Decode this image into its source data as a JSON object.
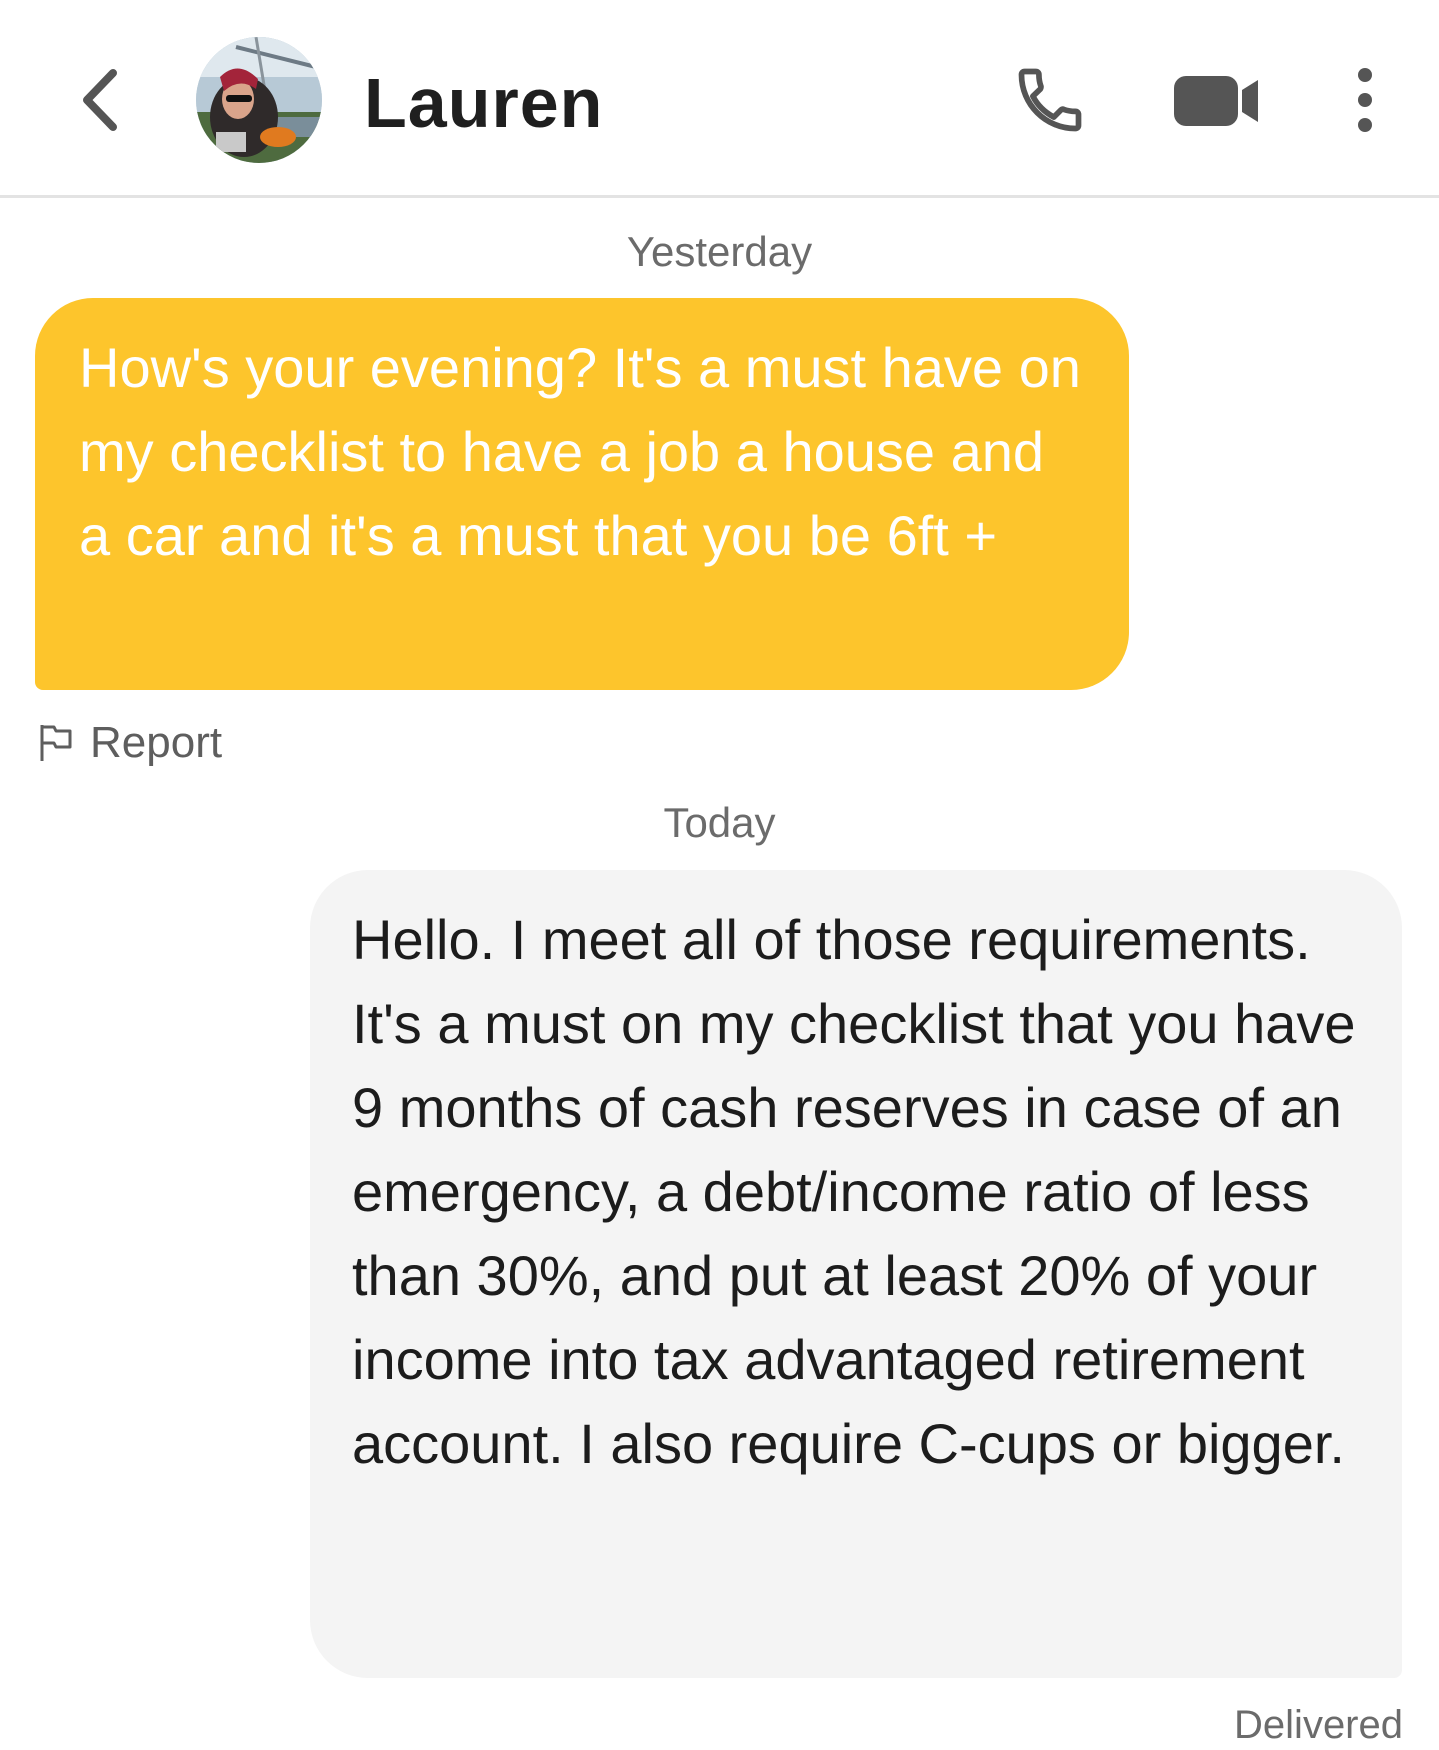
{
  "header": {
    "back_icon": "chevron-left-icon",
    "contact_name": "Lauren",
    "avatar": "contact-avatar",
    "call_icon": "phone-icon",
    "video_icon": "video-camera-icon",
    "more_icon": "more-vertical-icon"
  },
  "conversation": {
    "sections": [
      {
        "date_label": "Yesterday",
        "messages": [
          {
            "direction": "incoming",
            "text": "How's your evening? It's a must have on my checklist to have a job a house and a car and it's a must that you be 6ft +",
            "bubble_color": "#fdc52c"
          }
        ],
        "report_label": "Report"
      },
      {
        "date_label": "Today",
        "messages": [
          {
            "direction": "outgoing",
            "text": "Hello. I meet all of those requirements. It's a must on my checklist that you have 9 months of cash reserves in case of an emergency, a debt/income ratio of less than 30%, and put at least 20% of your income into tax advantaged retirement account. I also require C-cups or bigger.",
            "bubble_color": "#f4f4f4",
            "status": "Delivered"
          }
        ]
      }
    ]
  }
}
